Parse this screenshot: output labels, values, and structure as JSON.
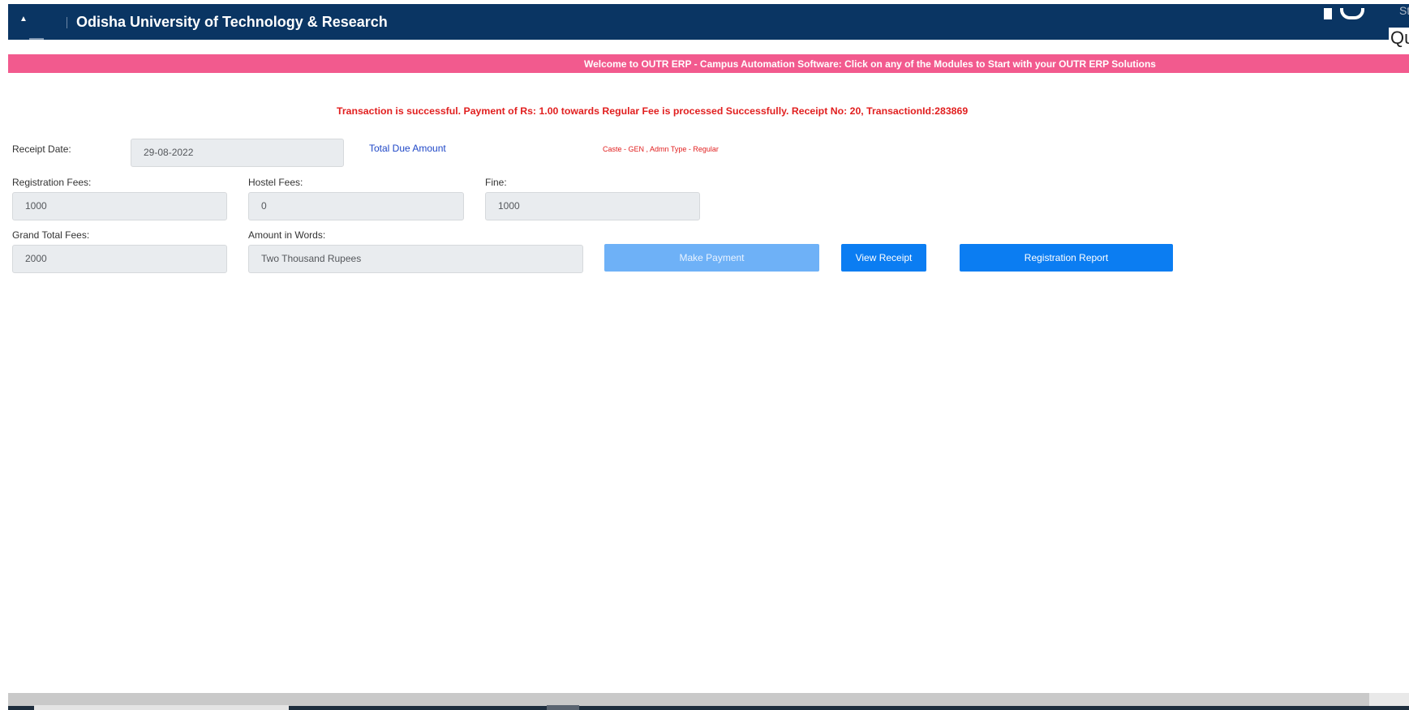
{
  "header": {
    "title": "Odisha University of Technology & Research",
    "right_text_1": "St",
    "right_text_2": "Qu"
  },
  "banner": {
    "text": "Welcome to OUTR ERP - Campus Automation Software: Click on any of the Modules to Start with your OUTR ERP Solutions"
  },
  "message": {
    "text": "Transaction is successful. Payment of Rs: 1.00 towards Regular Fee is processed Successfully. Receipt No: 20, TransactionId:283869"
  },
  "form": {
    "receipt_date_label": "Receipt Date:",
    "receipt_date_value": "29-08-2022",
    "total_due_label": "Total Due Amount",
    "caste_text": "Caste - GEN , Admn Type - Regular",
    "registration_fees_label": "Registration Fees:",
    "registration_fees_value": "1000",
    "hostel_fees_label": "Hostel Fees:",
    "hostel_fees_value": "0",
    "fine_label": "Fine:",
    "fine_value": "1000",
    "grand_total_label": "Grand Total Fees:",
    "grand_total_value": "2000",
    "amount_words_label": "Amount in Words:",
    "amount_words_value": "Two Thousand Rupees"
  },
  "buttons": {
    "make_payment": "Make Payment",
    "view_receipt": "View Receipt",
    "registration_report": "Registration Report"
  },
  "colors": {
    "header_bg": "#0a3563",
    "banner_bg": "#f25a8e",
    "message_red": "#e11f1f",
    "link_blue": "#1f47c7",
    "button_blue": "#0b7df2",
    "button_disabled": "#6eb1f7"
  }
}
